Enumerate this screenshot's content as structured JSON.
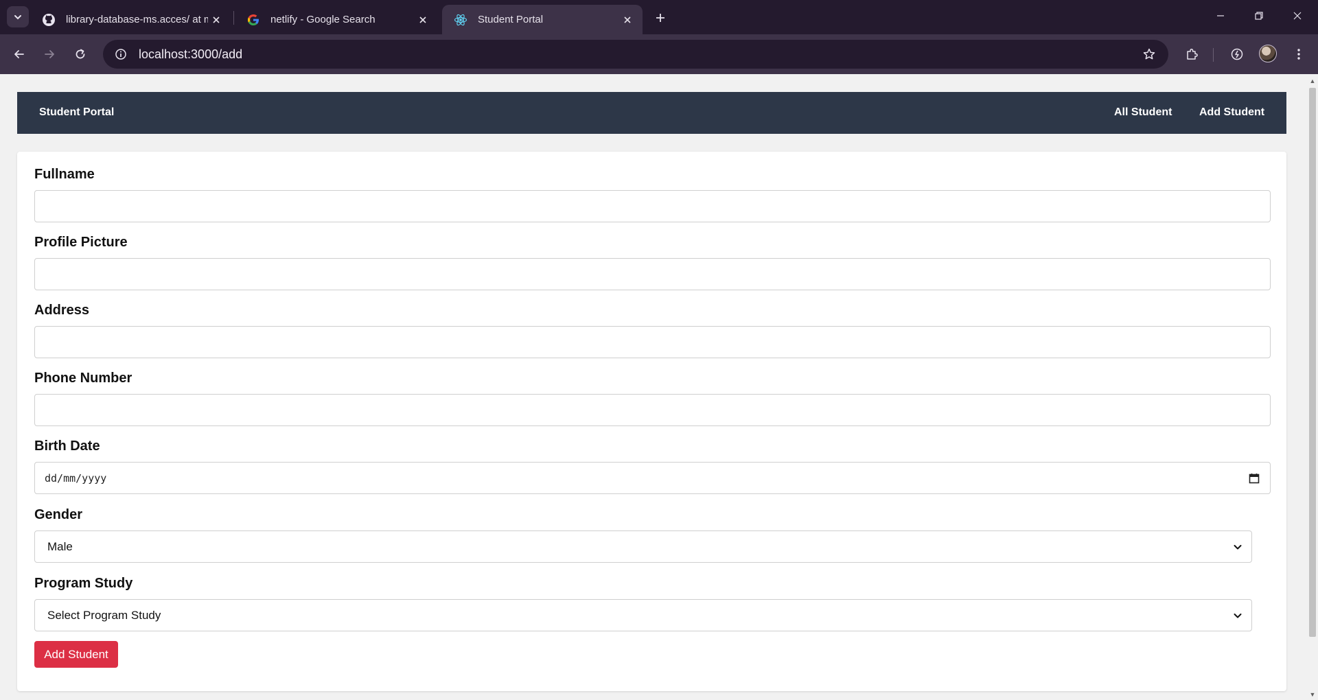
{
  "browser": {
    "tabs": [
      {
        "title": "library-database-ms.acces/ at m",
        "favicon": "github-icon",
        "active": false
      },
      {
        "title": "netlify - Google Search",
        "favicon": "google-icon",
        "active": false
      },
      {
        "title": "Student Portal",
        "favicon": "react-icon",
        "active": true
      }
    ],
    "url": "localhost:3000/add"
  },
  "navbar": {
    "brand": "Student Portal",
    "links": [
      "All Student",
      "Add Student"
    ],
    "background": "#2d3748"
  },
  "form": {
    "fields": [
      {
        "label": "Fullname",
        "value": ""
      },
      {
        "label": "Profile Picture",
        "value": ""
      },
      {
        "label": "Address",
        "value": ""
      },
      {
        "label": "Phone Number",
        "value": ""
      },
      {
        "label": "Birth Date",
        "placeholder": "dd/mm/yyyy"
      },
      {
        "label": "Gender",
        "selected": "Male"
      },
      {
        "label": "Program Study",
        "selected": "Select Program Study"
      }
    ],
    "submit_label": "Add Student",
    "submit_color": "#dc2f45"
  }
}
